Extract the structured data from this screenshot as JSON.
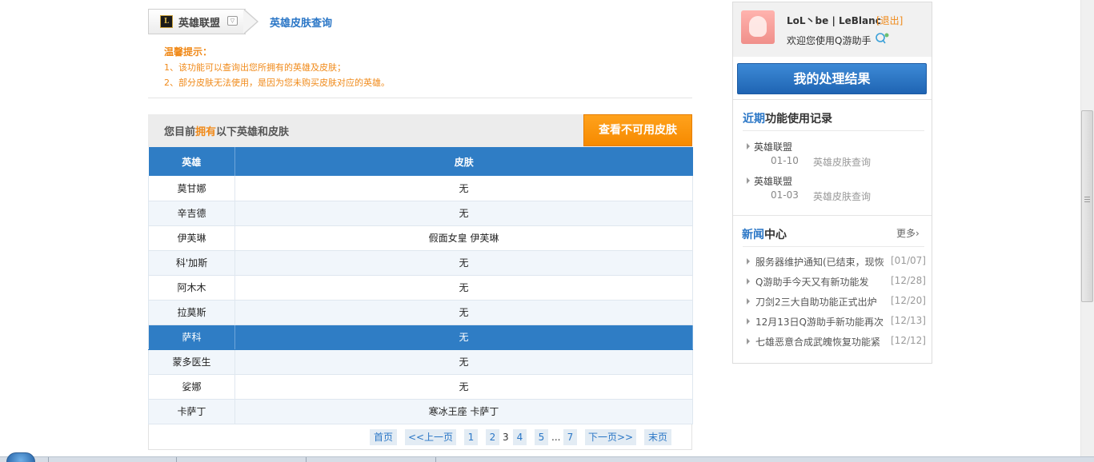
{
  "breadcrumb": {
    "game_logo_text": "L",
    "game": "英雄联盟",
    "current": "英雄皮肤查询"
  },
  "tips": {
    "title": "温馨提示：",
    "lines": [
      "1、该功能可以查询出您所拥有的英雄及皮肤；",
      "2、部分皮肤无法使用，是因为您未购买皮肤对应的英雄。"
    ]
  },
  "owned": {
    "prefix": "您目前",
    "highlight": "拥有",
    "suffix": "以下英雄和皮肤",
    "unavailable_button": "查看不可用皮肤"
  },
  "table": {
    "columns": [
      "英雄",
      "皮肤"
    ],
    "rows": [
      {
        "hero": "莫甘娜",
        "skin": "无"
      },
      {
        "hero": "辛吉德",
        "skin": "无"
      },
      {
        "hero": "伊芙琳",
        "skin": "假面女皇 伊芙琳"
      },
      {
        "hero": "科'加斯",
        "skin": "无"
      },
      {
        "hero": "阿木木",
        "skin": "无"
      },
      {
        "hero": "拉莫斯",
        "skin": "无"
      },
      {
        "hero": "萨科",
        "skin": "无"
      },
      {
        "hero": "蒙多医生",
        "skin": "无"
      },
      {
        "hero": "娑娜",
        "skin": "无"
      },
      {
        "hero": "卡萨丁",
        "skin": "寒冰王座 卡萨丁"
      }
    ]
  },
  "pager": {
    "first": "首页",
    "prev": "<<上一页",
    "p1": "1",
    "p2": "2",
    "current": "3",
    "p4": "4",
    "p5": "5",
    "ellipsis": "...",
    "p7": "7",
    "next": "下一页>>",
    "last": "末页"
  },
  "user": {
    "name": "LoL丶be | LeBlanc",
    "logout": "[退出]",
    "welcome": "欢迎您使用Q游助手"
  },
  "result_button": "我的处理结果",
  "recent": {
    "title_highlight": "近期",
    "title_rest": "功能使用记录",
    "items": [
      {
        "game": "英雄联盟",
        "date": "01-10",
        "func": "英雄皮肤查询"
      },
      {
        "game": "英雄联盟",
        "date": "01-03",
        "func": "英雄皮肤查询"
      }
    ]
  },
  "news": {
    "title_highlight": "新闻",
    "title_rest": "中心",
    "more": "更多›",
    "items": [
      {
        "title": "服务器维护通知(已结束，现恢",
        "date": "[01/07]"
      },
      {
        "title": "Q游助手今天又有新功能发",
        "date": "[12/28]"
      },
      {
        "title": "刀剑2三大自助功能正式出炉",
        "date": "[12/20]"
      },
      {
        "title": "12月13日Q游助手新功能再次",
        "date": "[12/13]"
      },
      {
        "title": "七雄恶意合成武魄恢复功能紧",
        "date": "[12/12]"
      }
    ]
  },
  "colors": {
    "accent_blue": "#2f7dc5",
    "accent_orange": "#f08a1a",
    "selected_row": "#2f7dc5"
  }
}
